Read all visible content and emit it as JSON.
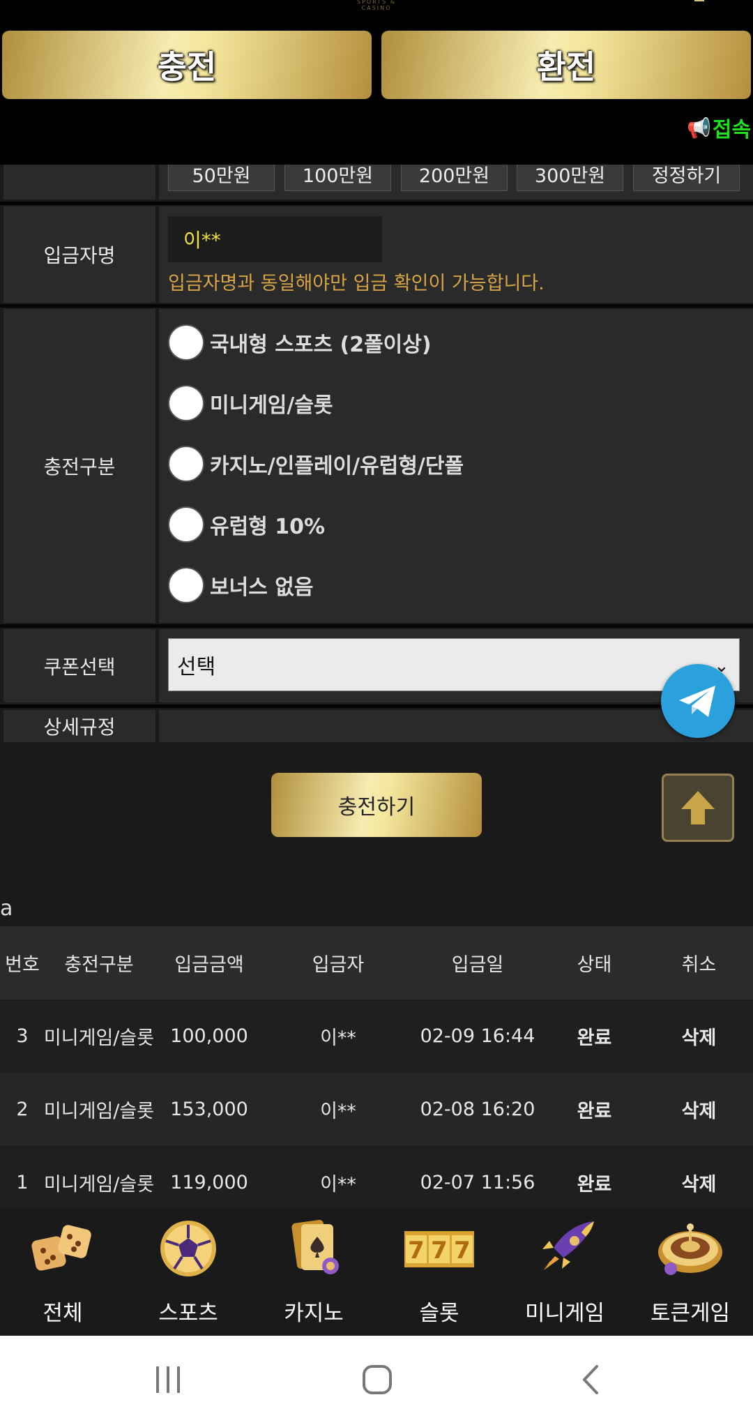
{
  "header": {
    "logo_small": "SPORTS & CASINO",
    "charge_label": "충전",
    "exchange_label": "환전",
    "ticker_text": "접속"
  },
  "amount_buttons": [
    "50만원",
    "100만원",
    "200만원",
    "300만원",
    "정정하기"
  ],
  "form": {
    "depositor_label": "입금자명",
    "depositor_value": "이**",
    "depositor_note": "입금자명과 동일해야만 입금 확인이 가능합니다.",
    "category_label": "충전구분",
    "category_options": [
      "국내형 스포츠 (2폴이상)",
      "미니게임/슬롯",
      "카지노/인플레이/유럽형/단폴",
      "유럽형 10%",
      "보너스 없음"
    ],
    "coupon_label": "쿠폰선택",
    "coupon_value": "선택",
    "rules_label": "상세규정",
    "submit_label": "충전하기"
  },
  "history": {
    "label": "a",
    "columns": [
      "번호",
      "충전구분",
      "입금금액",
      "입금자",
      "입금일",
      "상태",
      "취소"
    ],
    "rows": [
      [
        "3",
        "미니게임/슬롯",
        "100,000",
        "이**",
        "02-09 16:44",
        "완료",
        "삭제"
      ],
      [
        "2",
        "미니게임/슬롯",
        "153,000",
        "이**",
        "02-08 16:20",
        "완료",
        "삭제"
      ],
      [
        "1",
        "미니게임/슬롯",
        "119,000",
        "이**",
        "02-07 11:56",
        "완료",
        "삭제"
      ]
    ]
  },
  "bottom_nav": [
    {
      "label": "전체",
      "icon": "dice-icon"
    },
    {
      "label": "스포츠",
      "icon": "soccer-ball-icon"
    },
    {
      "label": "카지노",
      "icon": "cards-icon"
    },
    {
      "label": "슬롯",
      "icon": "slot-777-icon"
    },
    {
      "label": "미니게임",
      "icon": "rocket-icon"
    },
    {
      "label": "토큰게임",
      "icon": "roulette-icon"
    }
  ],
  "colors": {
    "gold_light": "#f7ecb1",
    "gold_dark": "#b08f3c",
    "ticker_green": "#1ee01e",
    "note_orange": "#d7a545",
    "depositor_yellow": "#f4e23a",
    "telegram_blue": "#2aa0dc"
  }
}
